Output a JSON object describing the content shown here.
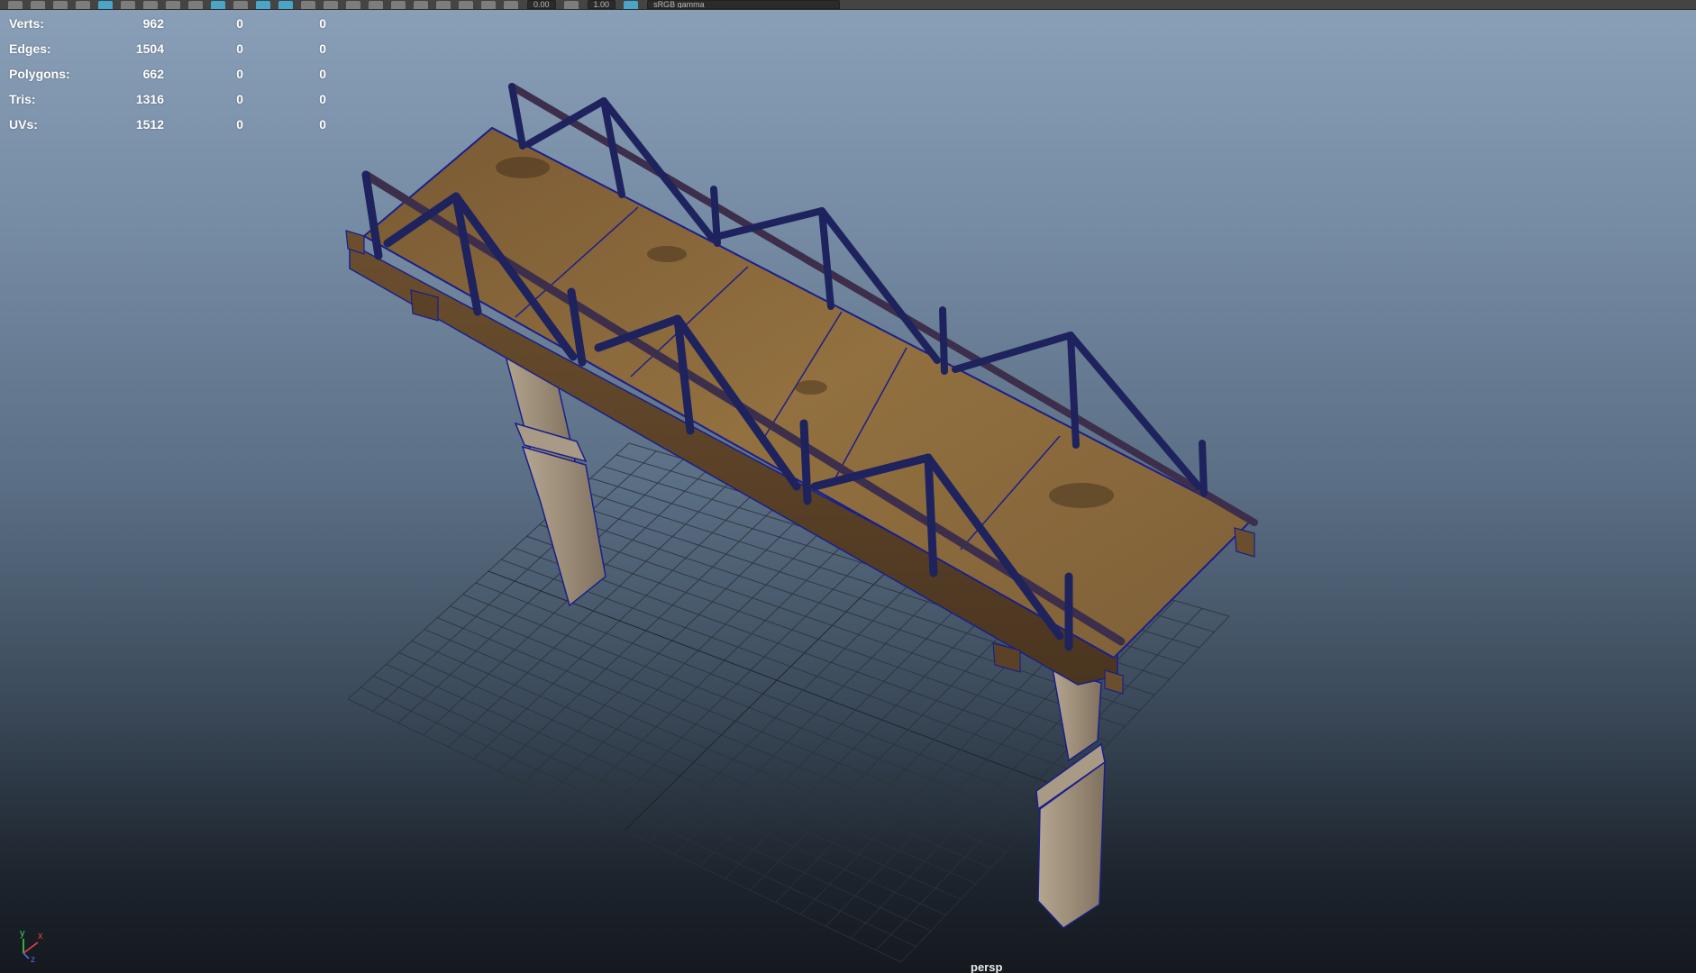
{
  "toolbar": {
    "fields": [
      "0.00",
      "1.00",
      "sRGB gamma"
    ]
  },
  "hud": {
    "rows": [
      {
        "label": "Verts:",
        "v1": "962",
        "v2": "0",
        "v3": "0"
      },
      {
        "label": "Edges:",
        "v1": "1504",
        "v2": "0",
        "v3": "0"
      },
      {
        "label": "Polygons:",
        "v1": "662",
        "v2": "0",
        "v3": "0"
      },
      {
        "label": "Tris:",
        "v1": "1316",
        "v2": "0",
        "v3": "0"
      },
      {
        "label": "UVs:",
        "v1": "1512",
        "v2": "0",
        "v3": "0"
      }
    ]
  },
  "axis": {
    "y": "y",
    "x": "x",
    "z": "z"
  },
  "camera": "persp",
  "colors": {
    "wireframe": "#1a1f8a",
    "wood": "#8a6a42",
    "stone": "#9a8a78",
    "grid": "#2a2f36"
  }
}
